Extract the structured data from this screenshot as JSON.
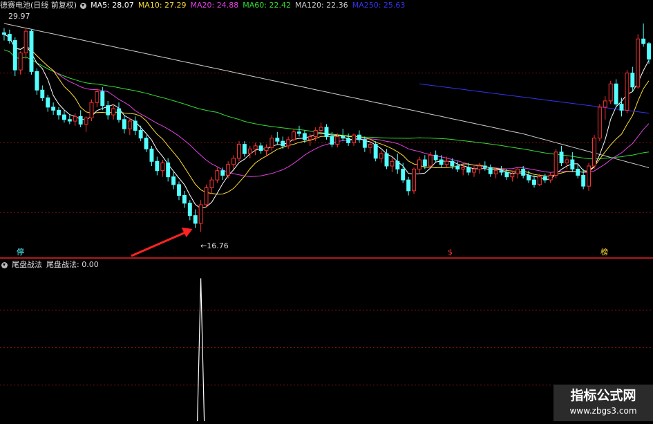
{
  "header": {
    "title": "德赛电池(日线 前复权)",
    "ma": [
      {
        "label": "MA5: 28.07",
        "color": "#ffffff"
      },
      {
        "label": "MA10: 27.29",
        "color": "#ffdd33"
      },
      {
        "label": "MA20: 24.88",
        "color": "#e040e0"
      },
      {
        "label": "MA60: 22.42",
        "color": "#33dd33"
      },
      {
        "label": "MA120: 22.36",
        "color": "#cccccc"
      },
      {
        "label": "MA250: 25.63",
        "color": "#3333ee"
      }
    ]
  },
  "indicator": {
    "name": "尾盘战法",
    "value_label": "尾盘战法: 0.00"
  },
  "annotations": {
    "high": "29.97",
    "low": "←16.76",
    "marker_left": "停",
    "marker_mid": "$",
    "marker_right": "榜"
  },
  "watermark": {
    "title": "指标公式网",
    "url": "www.zbgs3.com"
  },
  "colors": {
    "up": "#ff3232",
    "down": "#54ffff",
    "grid": "#7a1010",
    "divider": "#b01a1a",
    "ma5": "#ffffff",
    "ma10": "#ffdd33",
    "ma20": "#e040e0",
    "ma60": "#33dd33",
    "ma120": "#cccccc",
    "ma250": "#3333ee",
    "signal": "#ffffff",
    "arrow": "#ff2222"
  },
  "chart_data": {
    "type": "candlestick",
    "ylim": [
      16.0,
      31.0
    ],
    "candles": [
      [
        29.6,
        29.9,
        29.1,
        29.5
      ],
      [
        29.5,
        29.8,
        28.9,
        29.1
      ],
      [
        29.1,
        29.3,
        26.8,
        27.2
      ],
      [
        27.2,
        28.4,
        26.9,
        28.3
      ],
      [
        28.3,
        29.9,
        27.9,
        29.7
      ],
      [
        29.7,
        29.8,
        26.9,
        27.1
      ],
      [
        27.1,
        27.3,
        25.6,
        25.9
      ],
      [
        25.9,
        26.2,
        25.2,
        25.4
      ],
      [
        25.4,
        25.6,
        24.5,
        24.8
      ],
      [
        24.8,
        25.1,
        24.3,
        24.6
      ],
      [
        24.6,
        24.8,
        24.0,
        24.3
      ],
      [
        24.3,
        24.6,
        23.8,
        24.0
      ],
      [
        24.0,
        24.3,
        23.7,
        23.9
      ],
      [
        23.9,
        24.4,
        23.6,
        24.2
      ],
      [
        24.2,
        24.6,
        23.5,
        23.7
      ],
      [
        23.7,
        24.2,
        23.2,
        24.1
      ],
      [
        24.1,
        25.3,
        23.9,
        25.1
      ],
      [
        25.1,
        26.0,
        24.8,
        25.8
      ],
      [
        25.8,
        26.1,
        24.6,
        24.9
      ],
      [
        24.9,
        25.2,
        24.0,
        24.3
      ],
      [
        24.3,
        25.0,
        24.0,
        24.7
      ],
      [
        24.7,
        25.1,
        23.8,
        24.0
      ],
      [
        24.0,
        24.3,
        23.1,
        23.4
      ],
      [
        23.4,
        24.1,
        23.0,
        23.9
      ],
      [
        23.9,
        24.2,
        23.0,
        23.3
      ],
      [
        23.3,
        23.6,
        22.6,
        22.8
      ],
      [
        22.8,
        23.0,
        21.9,
        22.1
      ],
      [
        22.1,
        22.3,
        21.0,
        21.3
      ],
      [
        21.3,
        21.6,
        20.4,
        20.7
      ],
      [
        20.7,
        21.4,
        20.3,
        21.2
      ],
      [
        21.2,
        21.5,
        20.0,
        20.3
      ],
      [
        20.3,
        20.6,
        19.5,
        19.8
      ],
      [
        19.8,
        20.0,
        18.8,
        19.1
      ],
      [
        19.1,
        19.4,
        18.3,
        18.6
      ],
      [
        18.6,
        18.8,
        17.5,
        17.8
      ],
      [
        17.8,
        18.2,
        17.0,
        17.3
      ],
      [
        17.3,
        18.8,
        16.76,
        18.5
      ],
      [
        18.5,
        19.8,
        18.3,
        19.6
      ],
      [
        19.6,
        20.3,
        19.2,
        20.1
      ],
      [
        20.1,
        20.9,
        19.9,
        20.7
      ],
      [
        20.7,
        20.9,
        20.1,
        20.4
      ],
      [
        20.4,
        21.3,
        20.2,
        21.1
      ],
      [
        21.1,
        21.7,
        20.8,
        21.5
      ],
      [
        21.5,
        22.6,
        21.3,
        22.4
      ],
      [
        22.4,
        22.6,
        21.6,
        21.8
      ],
      [
        21.8,
        22.3,
        21.5,
        22.1
      ],
      [
        22.1,
        22.5,
        21.7,
        22.3
      ],
      [
        22.3,
        22.5,
        21.8,
        22.0
      ],
      [
        22.0,
        22.4,
        21.6,
        22.2
      ],
      [
        22.2,
        23.0,
        22.0,
        22.8
      ],
      [
        22.8,
        23.2,
        22.4,
        22.6
      ],
      [
        22.6,
        22.9,
        22.1,
        22.3
      ],
      [
        22.3,
        22.9,
        22.1,
        22.7
      ],
      [
        22.7,
        23.4,
        22.6,
        23.2
      ],
      [
        23.2,
        23.6,
        22.9,
        23.1
      ],
      [
        23.1,
        23.3,
        22.5,
        22.7
      ],
      [
        22.7,
        23.1,
        22.3,
        22.9
      ],
      [
        22.9,
        23.5,
        22.6,
        23.3
      ],
      [
        23.3,
        23.8,
        23.0,
        23.5
      ],
      [
        23.5,
        23.7,
        22.7,
        22.9
      ],
      [
        22.9,
        23.2,
        22.2,
        22.4
      ],
      [
        22.4,
        23.1,
        22.2,
        22.9
      ],
      [
        22.9,
        23.4,
        22.6,
        22.8
      ],
      [
        22.8,
        23.1,
        22.3,
        22.5
      ],
      [
        22.5,
        23.1,
        22.3,
        23.0
      ],
      [
        23.0,
        23.3,
        22.5,
        22.7
      ],
      [
        22.7,
        22.9,
        21.9,
        22.2
      ],
      [
        22.2,
        22.6,
        21.8,
        22.4
      ],
      [
        22.4,
        22.6,
        21.3,
        21.5
      ],
      [
        21.5,
        22.0,
        21.2,
        21.8
      ],
      [
        21.8,
        22.1,
        20.8,
        21.0
      ],
      [
        21.0,
        21.5,
        20.6,
        21.3
      ],
      [
        21.3,
        21.8,
        20.5,
        20.8
      ],
      [
        20.8,
        21.2,
        19.9,
        20.1
      ],
      [
        20.1,
        20.3,
        19.1,
        19.4
      ],
      [
        19.4,
        20.9,
        19.2,
        20.8
      ],
      [
        20.8,
        21.6,
        20.5,
        21.4
      ],
      [
        21.4,
        21.7,
        20.8,
        21.0
      ],
      [
        21.0,
        21.9,
        20.9,
        21.7
      ],
      [
        21.7,
        22.0,
        21.2,
        21.4
      ],
      [
        21.4,
        21.7,
        20.9,
        21.1
      ],
      [
        21.1,
        21.6,
        20.9,
        21.3
      ],
      [
        21.3,
        21.5,
        20.8,
        21.0
      ],
      [
        21.0,
        21.3,
        20.6,
        20.8
      ],
      [
        20.8,
        21.1,
        20.4,
        20.9
      ],
      [
        20.9,
        21.2,
        20.4,
        20.6
      ],
      [
        20.6,
        21.0,
        20.3,
        20.8
      ],
      [
        20.8,
        21.2,
        20.5,
        21.0
      ],
      [
        21.0,
        21.3,
        20.7,
        20.9
      ],
      [
        20.9,
        21.1,
        20.3,
        20.5
      ],
      [
        20.5,
        20.9,
        20.2,
        20.7
      ],
      [
        20.7,
        21.0,
        20.4,
        20.6
      ],
      [
        20.6,
        20.8,
        20.1,
        20.3
      ],
      [
        20.3,
        20.7,
        20.0,
        20.5
      ],
      [
        20.5,
        20.9,
        20.2,
        20.8
      ],
      [
        20.8,
        21.0,
        20.2,
        20.4
      ],
      [
        20.4,
        20.7,
        19.9,
        20.1
      ],
      [
        20.1,
        20.4,
        19.6,
        19.8
      ],
      [
        19.8,
        20.5,
        19.7,
        20.3
      ],
      [
        20.3,
        20.5,
        19.9,
        20.1
      ],
      [
        20.1,
        20.6,
        19.9,
        20.4
      ],
      [
        20.4,
        22.1,
        20.2,
        21.9
      ],
      [
        21.9,
        22.3,
        21.0,
        21.2
      ],
      [
        21.2,
        21.6,
        20.8,
        21.4
      ],
      [
        21.4,
        21.9,
        20.6,
        20.8
      ],
      [
        20.8,
        21.1,
        20.2,
        20.4
      ],
      [
        20.4,
        20.8,
        19.5,
        19.7
      ],
      [
        19.7,
        21.2,
        19.4,
        21.0
      ],
      [
        21.0,
        23.0,
        20.8,
        22.8
      ],
      [
        22.8,
        25.0,
        22.6,
        24.8
      ],
      [
        24.8,
        25.5,
        24.0,
        25.2
      ],
      [
        25.2,
        26.5,
        25.0,
        26.3
      ],
      [
        26.3,
        26.6,
        24.8,
        25.0
      ],
      [
        25.0,
        25.4,
        24.2,
        24.6
      ],
      [
        24.6,
        27.2,
        24.4,
        27.0
      ],
      [
        27.0,
        27.4,
        25.8,
        26.1
      ],
      [
        26.1,
        29.5,
        26.0,
        29.2
      ],
      [
        29.2,
        30.2,
        28.7,
        28.9
      ],
      [
        28.9,
        29.0,
        27.6,
        27.9
      ]
    ],
    "signal": {
      "x_index": 36,
      "value": 1.0,
      "ylim": [
        0,
        1.05
      ]
    },
    "high_label_value": 29.97,
    "low_label_value": 16.76
  }
}
